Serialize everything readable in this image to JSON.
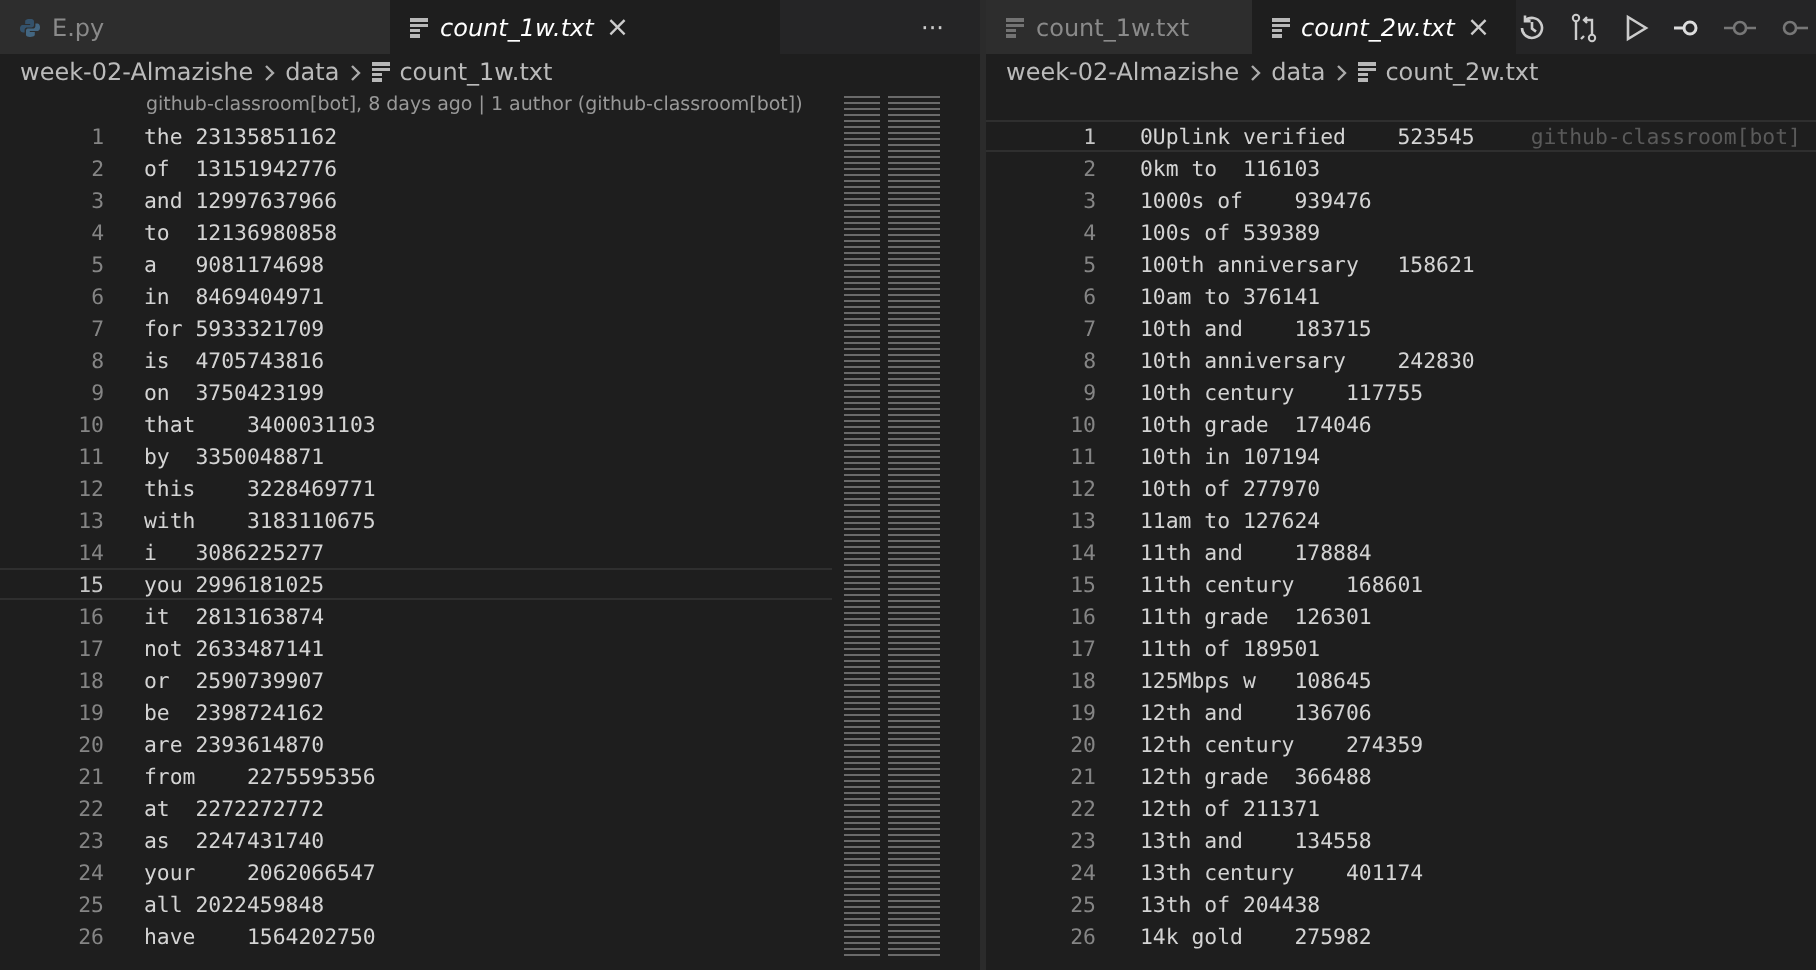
{
  "left_editor": {
    "tabs": [
      {
        "label": "E.py",
        "kind": "python",
        "selected": false
      },
      {
        "label": "count_1w.txt",
        "kind": "text",
        "selected": true,
        "close": "×"
      }
    ],
    "more": "···",
    "breadcrumb": [
      "week-02-Almazishe",
      "data",
      "count_1w.txt"
    ],
    "codelens": "github-classroom[bot], 8 days ago | 1 author (github-classroom[bot])",
    "lines": [
      {
        "n": "1",
        "text": "the\t23135851162",
        "current": false
      },
      {
        "n": "2",
        "text": "of\t13151942776",
        "current": false
      },
      {
        "n": "3",
        "text": "and\t12997637966",
        "current": false
      },
      {
        "n": "4",
        "text": "to\t12136980858",
        "current": false
      },
      {
        "n": "5",
        "text": "a\t9081174698",
        "current": false
      },
      {
        "n": "6",
        "text": "in\t8469404971",
        "current": false
      },
      {
        "n": "7",
        "text": "for\t5933321709",
        "current": false
      },
      {
        "n": "8",
        "text": "is\t4705743816",
        "current": false
      },
      {
        "n": "9",
        "text": "on\t3750423199",
        "current": false
      },
      {
        "n": "10",
        "text": "that\t3400031103",
        "current": false
      },
      {
        "n": "11",
        "text": "by\t3350048871",
        "current": false
      },
      {
        "n": "12",
        "text": "this\t3228469771",
        "current": false
      },
      {
        "n": "13",
        "text": "with\t3183110675",
        "current": false
      },
      {
        "n": "14",
        "text": "i\t3086225277",
        "current": false
      },
      {
        "n": "15",
        "text": "you\t2996181025",
        "current": true
      },
      {
        "n": "16",
        "text": "it\t2813163874",
        "current": false
      },
      {
        "n": "17",
        "text": "not\t2633487141",
        "current": false
      },
      {
        "n": "18",
        "text": "or\t2590739907",
        "current": false
      },
      {
        "n": "19",
        "text": "be\t2398724162",
        "current": false
      },
      {
        "n": "20",
        "text": "are\t2393614870",
        "current": false
      },
      {
        "n": "21",
        "text": "from\t2275595356",
        "current": false
      },
      {
        "n": "22",
        "text": "at\t2272272772",
        "current": false
      },
      {
        "n": "23",
        "text": "as\t2247431740",
        "current": false
      },
      {
        "n": "24",
        "text": "your\t2062066547",
        "current": false
      },
      {
        "n": "25",
        "text": "all\t2022459848",
        "current": false
      },
      {
        "n": "26",
        "text": "have\t1564202750",
        "current": false
      }
    ]
  },
  "right_editor": {
    "tabs": [
      {
        "label": "count_1w.txt",
        "kind": "text",
        "selected": false
      },
      {
        "label": "count_2w.txt",
        "kind": "text",
        "selected": true,
        "close": "×"
      }
    ],
    "breadcrumb": [
      "week-02-Almazishe",
      "data",
      "count_2w.txt"
    ],
    "blame": "github-classroom[bot]",
    "lines": [
      {
        "n": "1",
        "text": "0Uplink verified\t523545",
        "current": true
      },
      {
        "n": "2",
        "text": "0km to\t116103",
        "current": false
      },
      {
        "n": "3",
        "text": "1000s of\t939476",
        "current": false
      },
      {
        "n": "4",
        "text": "100s of\t539389",
        "current": false
      },
      {
        "n": "5",
        "text": "100th anniversary\t158621",
        "current": false
      },
      {
        "n": "6",
        "text": "10am to\t376141",
        "current": false
      },
      {
        "n": "7",
        "text": "10th and\t183715",
        "current": false
      },
      {
        "n": "8",
        "text": "10th anniversary\t242830",
        "current": false
      },
      {
        "n": "9",
        "text": "10th century\t117755",
        "current": false
      },
      {
        "n": "10",
        "text": "10th grade\t174046",
        "current": false
      },
      {
        "n": "11",
        "text": "10th in\t107194",
        "current": false
      },
      {
        "n": "12",
        "text": "10th of\t277970",
        "current": false
      },
      {
        "n": "13",
        "text": "11am to\t127624",
        "current": false
      },
      {
        "n": "14",
        "text": "11th and\t178884",
        "current": false
      },
      {
        "n": "15",
        "text": "11th century\t168601",
        "current": false
      },
      {
        "n": "16",
        "text": "11th grade\t126301",
        "current": false
      },
      {
        "n": "17",
        "text": "11th of\t189501",
        "current": false
      },
      {
        "n": "18",
        "text": "125Mbps w\t108645",
        "current": false
      },
      {
        "n": "19",
        "text": "12th and\t136706",
        "current": false
      },
      {
        "n": "20",
        "text": "12th century\t274359",
        "current": false
      },
      {
        "n": "21",
        "text": "12th grade\t366488",
        "current": false
      },
      {
        "n": "22",
        "text": "12th of\t211371",
        "current": false
      },
      {
        "n": "23",
        "text": "13th and\t134558",
        "current": false
      },
      {
        "n": "24",
        "text": "13th century\t401174",
        "current": false
      },
      {
        "n": "25",
        "text": "13th of\t204438",
        "current": false
      },
      {
        "n": "26",
        "text": "14k gold\t275982",
        "current": false
      }
    ]
  }
}
